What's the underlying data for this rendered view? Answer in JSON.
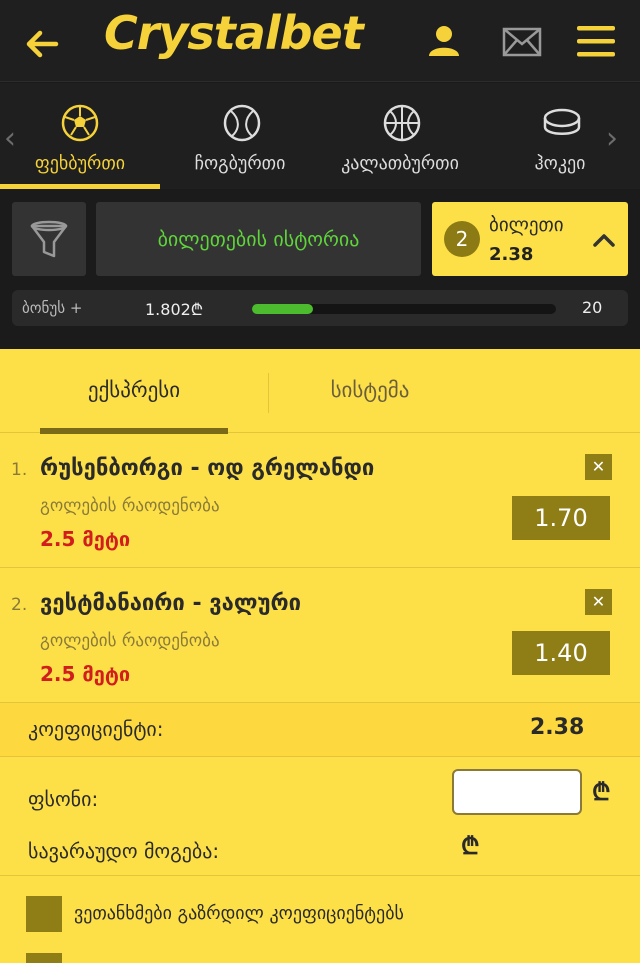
{
  "header": {
    "logo": "Crystalbet"
  },
  "sports": [
    {
      "label": "ფეხბურთი",
      "icon": "soccer-ball-icon",
      "active": true
    },
    {
      "label": "ჩოგბურთი",
      "icon": "tennis-ball-icon",
      "active": false
    },
    {
      "label": "კალათბურთი",
      "icon": "basketball-icon",
      "active": false
    },
    {
      "label": "ჰოკეი",
      "icon": "hockey-puck-icon",
      "active": false
    }
  ],
  "controls": {
    "history_label": "ბილეთების ისტორია",
    "ticket_count": "2",
    "ticket_label": "ბილეთი",
    "ticket_odds": "2.38"
  },
  "bonus": {
    "label": "ბონუს +",
    "amount": "1.802₾",
    "progress": 0.2,
    "target": "20"
  },
  "slip": {
    "tab_express": "ექსპრესი",
    "tab_system": "სისტემა",
    "bets": [
      {
        "num": "1.",
        "match": "რუსენბორგი - ოდ გრელანდი",
        "market": "გოლების რაოდენობა",
        "pick": "2.5 მეტი",
        "odd": "1.70"
      },
      {
        "num": "2.",
        "match": "ვესტმანაირი - ვალური",
        "market": "გოლების რაოდენობა",
        "pick": "2.5 მეტი",
        "odd": "1.40"
      }
    ],
    "coef_label": "კოეფიციენტი:",
    "coef_value": "2.38",
    "stake_label": "ფსონი:",
    "stake_value": "",
    "currency": "₾",
    "win_label": "სავარაუდო მოგება:",
    "option1": "ვეთანხმები გაზრდილ კოეფიციენტებს"
  },
  "colors": {
    "brand_yellow": "#f5d23a",
    "slip_bg": "#fde047",
    "odd_bg": "#8f7d16",
    "pick_red": "#d11d1d",
    "history_green": "#5ed53a"
  }
}
